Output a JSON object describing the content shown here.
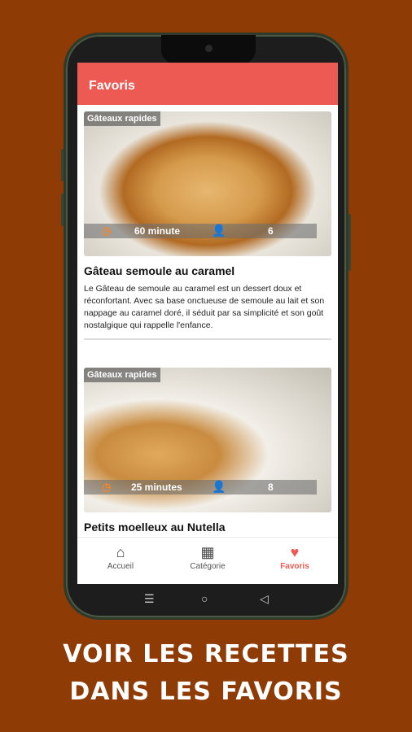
{
  "appbar": {
    "title": "Favoris"
  },
  "recipes": [
    {
      "category": "Gâteaux rapides",
      "time": "60 minute",
      "servings": "6",
      "title": "Gâteau semoule au caramel",
      "description": "Le Gâteau de semoule au caramel est un dessert doux et réconfortant. Avec sa base onctueuse de semoule au lait et son nappage au caramel doré, il séduit par sa simplicité et son goût nostalgique qui rappelle l'enfance."
    },
    {
      "category": "Gâteaux rapides",
      "time": "25 minutes",
      "servings": "8",
      "title": "Petits moelleux au Nutella",
      "description": ""
    }
  ],
  "bottom_nav": [
    {
      "label": "Accueil",
      "icon": "home-icon",
      "active": false
    },
    {
      "label": "Catégorie",
      "icon": "grid-icon",
      "active": false
    },
    {
      "label": "Favoris",
      "icon": "heart-icon",
      "active": true
    }
  ],
  "caption": {
    "line1": "VOIR LES RECETTES",
    "line2": "DANS LES FAVORIS"
  },
  "colors": {
    "accent": "#ec5a53",
    "background": "#8e3b06",
    "highlight_ring": "#1b1aa8"
  }
}
